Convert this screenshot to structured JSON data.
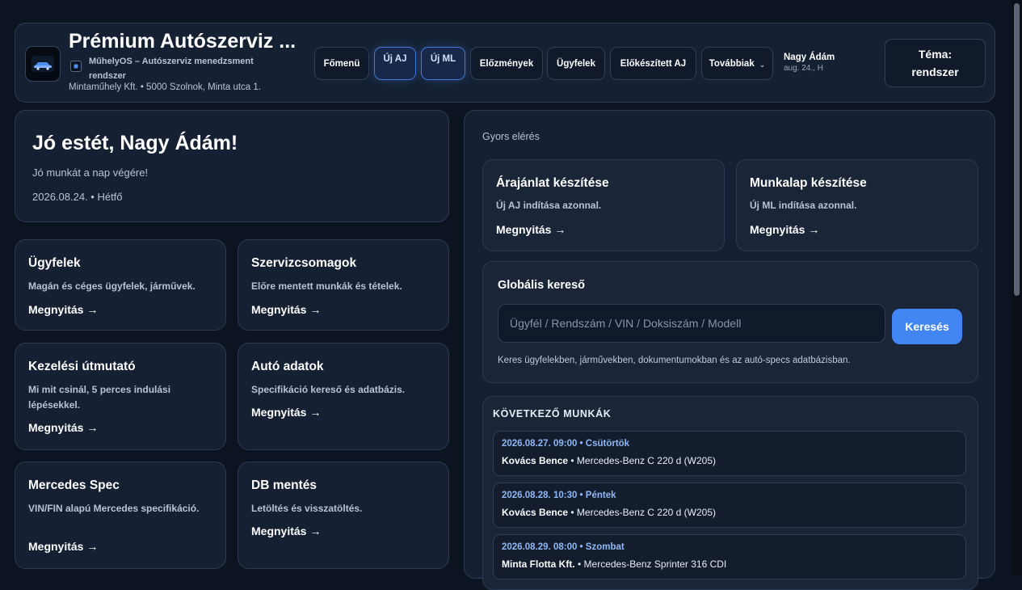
{
  "header": {
    "title": "Prémium Autószerviz ...",
    "subtitle": "MűhelyOS – Autószerviz menedzsment rendszer",
    "address": "Mintaműhely Kft. • 5000 Szolnok, Minta utca 1.",
    "logo_icon": "car-logo-icon",
    "nav": {
      "home": "Főmenü",
      "new_quote": "Új AJ",
      "new_worksheet": "Új ML",
      "history": "Előzmények",
      "clients": "Ügyfelek",
      "prepared_quotes": "Előkészített AJ",
      "more": "Továbbiak"
    },
    "user": {
      "name": "Nagy Ádám",
      "date": "aug. 24., H"
    },
    "theme": {
      "label": "Téma:",
      "value": "rendszer"
    }
  },
  "greeting": {
    "title": "Jó estét, Nagy Ádám!",
    "subtitle": "Jó munkát a nap végére!",
    "date": "2026.08.24. • Hétfő"
  },
  "cards": [
    {
      "title": "Ügyfelek",
      "desc": "Magán és céges ügyfelek, járművek.",
      "link": "Megnyitás →"
    },
    {
      "title": "Szervizcsomagok",
      "desc": "Előre mentett munkák és tételek.",
      "link": "Megnyitás →"
    },
    {
      "title": "Kezelési útmutató",
      "desc": "Mi mit csinál, 5 perces indulási lépésekkel.",
      "link": "Megnyitás →"
    },
    {
      "title": "Autó adatok",
      "desc": "Specifikáció kereső és adatbázis.",
      "link": "Megnyitás →"
    },
    {
      "title": "Mercedes Spec",
      "desc": "VIN/FIN alapú Mercedes specifikáció.",
      "link": "Megnyitás →"
    },
    {
      "title": "DB mentés",
      "desc": "Letöltés és visszatöltés.",
      "link": "Megnyitás →"
    }
  ],
  "quick": {
    "label": "Gyors elérés",
    "quote": {
      "title": "Árajánlat készítése",
      "desc": "Új AJ indítása azonnal.",
      "link": "Megnyitás →"
    },
    "worksheet": {
      "title": "Munkalap készítése",
      "desc": "Új ML indítása azonnal.",
      "link": "Megnyitás →"
    }
  },
  "search": {
    "title": "Globális kereső",
    "placeholder": "Ügyfél / Rendszám / VIN / Doksiszám / Modell",
    "value": "",
    "button": "Keresés",
    "hint": "Keres ügyfelekben, járművekben, dokumentumokban és az autó-specs adatbázisban."
  },
  "next_jobs": {
    "title": "KÖVETKEZŐ MUNKÁK",
    "items": [
      {
        "date": "2026.08.27. 09:00 • Csütörtök",
        "client": "Kovács Bence",
        "vehicle": " • Mercedes-Benz C 220 d (W205)"
      },
      {
        "date": "2026.08.28. 10:30 • Péntek",
        "client": "Kovács Bence",
        "vehicle": " • Mercedes-Benz C 220 d (W205)"
      },
      {
        "date": "2026.08.29. 08:00 • Szombat",
        "client": "Minta Flotta Kft.",
        "vehicle": " • Mercedes-Benz Sprinter 316 CDI"
      }
    ]
  },
  "colors": {
    "background": "#0c1422",
    "panel": "#152032",
    "accent": "#4286f4",
    "date_text": "#8fb8f5"
  }
}
